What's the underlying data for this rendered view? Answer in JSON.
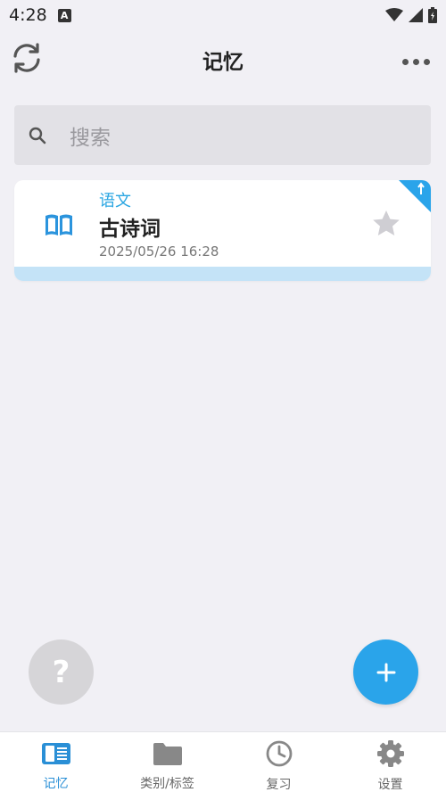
{
  "status_bar": {
    "time": "4:28",
    "notification_letter": "A"
  },
  "app_bar": {
    "title": "记忆",
    "refresh_icon": "refresh-icon",
    "more_icon": "more-horizontal-icon"
  },
  "search": {
    "placeholder": "搜索"
  },
  "cards": [
    {
      "category": "语文",
      "title": "古诗词",
      "date": "2025/05/26 16:28",
      "icon": "book-open-icon",
      "starred": false,
      "pinned": true
    }
  ],
  "fabs": {
    "help_label": "?",
    "add_icon": "plus-icon"
  },
  "bottom_nav": {
    "items": [
      {
        "label": "记忆",
        "icon": "memory-card-icon",
        "active": true
      },
      {
        "label": "类别/标签",
        "icon": "folder-icon",
        "active": false
      },
      {
        "label": "复习",
        "icon": "clock-icon",
        "active": false
      },
      {
        "label": "设置",
        "icon": "gear-icon",
        "active": false
      }
    ]
  },
  "colors": {
    "accent": "#2aa4ea",
    "category_text": "#2aa6e2",
    "background": "#f1f0f5",
    "card_bottom_bar": "#c4e3f7"
  }
}
